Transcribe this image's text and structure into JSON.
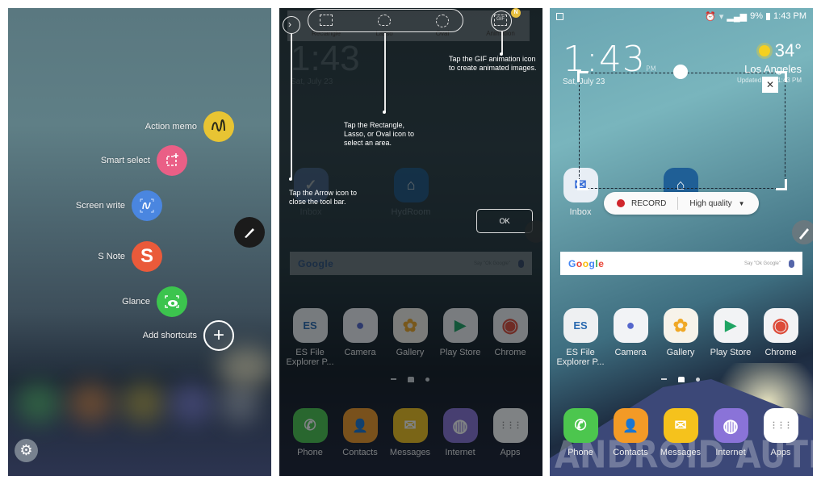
{
  "panel1": {
    "menu_items": [
      {
        "label": "Action memo",
        "icon": "action-memo-icon",
        "color": "#e8c433"
      },
      {
        "label": "Smart select",
        "icon": "smart-select-icon",
        "color": "#ea5f86"
      },
      {
        "label": "Screen write",
        "icon": "screen-write-icon",
        "color": "#4a86e0"
      },
      {
        "label": "S Note",
        "icon": "s-note-icon",
        "color": "#ea5a3a",
        "glyph": "S"
      },
      {
        "label": "Glance",
        "icon": "glance-icon",
        "color": "#3cc44e"
      }
    ],
    "add_shortcuts_label": "Add shortcuts",
    "add_glyph": "+",
    "settings_glyph": "⚙"
  },
  "panel2": {
    "tools": [
      {
        "label": "Rectangle",
        "icon": "rectangle-icon"
      },
      {
        "label": "Lasso",
        "icon": "lasso-icon"
      },
      {
        "label": "Oval",
        "icon": "oval-icon"
      },
      {
        "label": "Animation",
        "icon": "gif-icon"
      }
    ],
    "gif_label": "GIF",
    "new_badge": "N",
    "tips": {
      "gif": "Tap the GIF animation icon to create animated images.",
      "select": "Tap the Rectangle, Lasso, or Oval icon to select an area.",
      "arrow": "Tap the Arrow icon to close the tool bar."
    },
    "ok_label": "OK"
  },
  "home": {
    "time": "1:43",
    "ampm": "PM",
    "date": "Sat, July 23",
    "weather": {
      "temp": "34°",
      "city": "Los Angeles",
      "updated": "Updated 7/23 1:43 PM"
    },
    "status": {
      "battery": "9%",
      "time": "1:43 PM"
    },
    "upper_apps": [
      {
        "label": "Inbox",
        "color": "#e8eef5"
      },
      {
        "label": "HydRoom",
        "color": "#1f5f96"
      }
    ],
    "google": {
      "logo": "Google",
      "hint": "Say \"Ok Google\""
    },
    "apps": [
      {
        "label": "ES File Explorer P...",
        "color": "#eef0f2",
        "glyph": "ES"
      },
      {
        "label": "Camera",
        "color": "#f2f3f6",
        "glyph": "●"
      },
      {
        "label": "Gallery",
        "color": "#f7f3ea",
        "glyph": "✿"
      },
      {
        "label": "Play Store",
        "color": "#f2f3f5",
        "glyph": "▶"
      },
      {
        "label": "Chrome",
        "color": "#f2f3f5",
        "glyph": "◉"
      }
    ],
    "dock": [
      {
        "label": "Phone",
        "color": "#4cc64e",
        "glyph": "✆"
      },
      {
        "label": "Contacts",
        "color": "#f39a26",
        "glyph": "👤"
      },
      {
        "label": "Messages",
        "color": "#f5c21c",
        "glyph": "✉"
      },
      {
        "label": "Internet",
        "color": "#8a73d8",
        "glyph": "◍"
      },
      {
        "label": "Apps",
        "color": "#ffffff",
        "glyph": "⋮⋮⋮"
      }
    ]
  },
  "panel3": {
    "record_label": "RECORD",
    "quality_label": "High quality",
    "dropdown_glyph": "▼",
    "close_glyph": "✕",
    "watermark": "ANDROID AUTHORITY"
  }
}
